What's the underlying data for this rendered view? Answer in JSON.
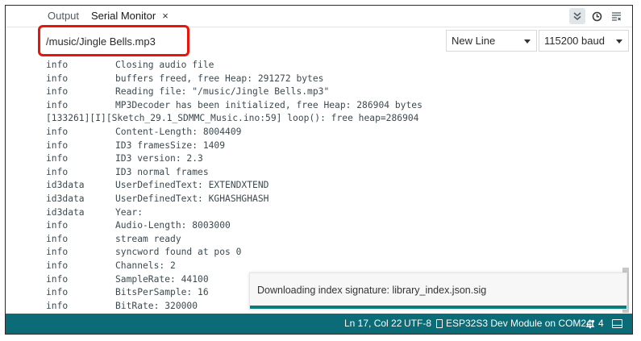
{
  "tabs": {
    "output_label": "Output",
    "serial_label": "Serial Monitor",
    "close_glyph": "×",
    "icons": [
      "double-chevron-down-icon",
      "clock-icon",
      "clear-lines-icon"
    ]
  },
  "input": {
    "value": "/music/Jingle Bells.mp3"
  },
  "line_ending": {
    "selected": "New Line"
  },
  "baud": {
    "selected": "115200 baud"
  },
  "log": [
    {
      "level": "info",
      "text": "Closing audio file"
    },
    {
      "level": "info",
      "text": "buffers freed, free Heap: 291272 bytes"
    },
    {
      "level": "info",
      "text": "Reading file: \"/music/Jingle Bells.mp3\""
    },
    {
      "level": "info",
      "text": "MP3Decoder has been initialized, free Heap: 286904 bytes"
    },
    {
      "full": "[133261][I][Sketch_29.1_SDMMC_Music.ino:59] loop(): free heap=286904"
    },
    {
      "level": "info",
      "text": "Content-Length: 8004409"
    },
    {
      "level": "info",
      "text": "ID3 framesSize: 1409"
    },
    {
      "level": "info",
      "text": "ID3 version: 2.3"
    },
    {
      "level": "info",
      "text": "ID3 normal frames"
    },
    {
      "level": "id3data",
      "text": "UserDefinedText: EXTENDXTEND"
    },
    {
      "level": "id3data",
      "text": "UserDefinedText: KGHASHGHASH"
    },
    {
      "level": "id3data",
      "text": "Year:"
    },
    {
      "level": "info",
      "text": "Audio-Length: 8003000"
    },
    {
      "level": "info",
      "text": "stream ready"
    },
    {
      "level": "info",
      "text": "syncword found at pos 0"
    },
    {
      "level": "info",
      "text": "Channels: 2"
    },
    {
      "level": "info",
      "text": "SampleRate: 44100"
    },
    {
      "level": "info",
      "text": "BitsPerSample: 16"
    },
    {
      "level": "info",
      "text": "BitRate: 320000"
    }
  ],
  "notification": {
    "text": "Downloading index signature: library_index.json.sig",
    "progress": 1.0
  },
  "status": {
    "position": "Ln 17, Col 22",
    "encoding": "UTF-8",
    "board": "ESP32S3 Dev Module on COM24",
    "notifications_count": "4"
  },
  "colors": {
    "status_bar": "#0b6b76",
    "highlight_box": "#e8150c",
    "progress": "#0b7a7a"
  }
}
